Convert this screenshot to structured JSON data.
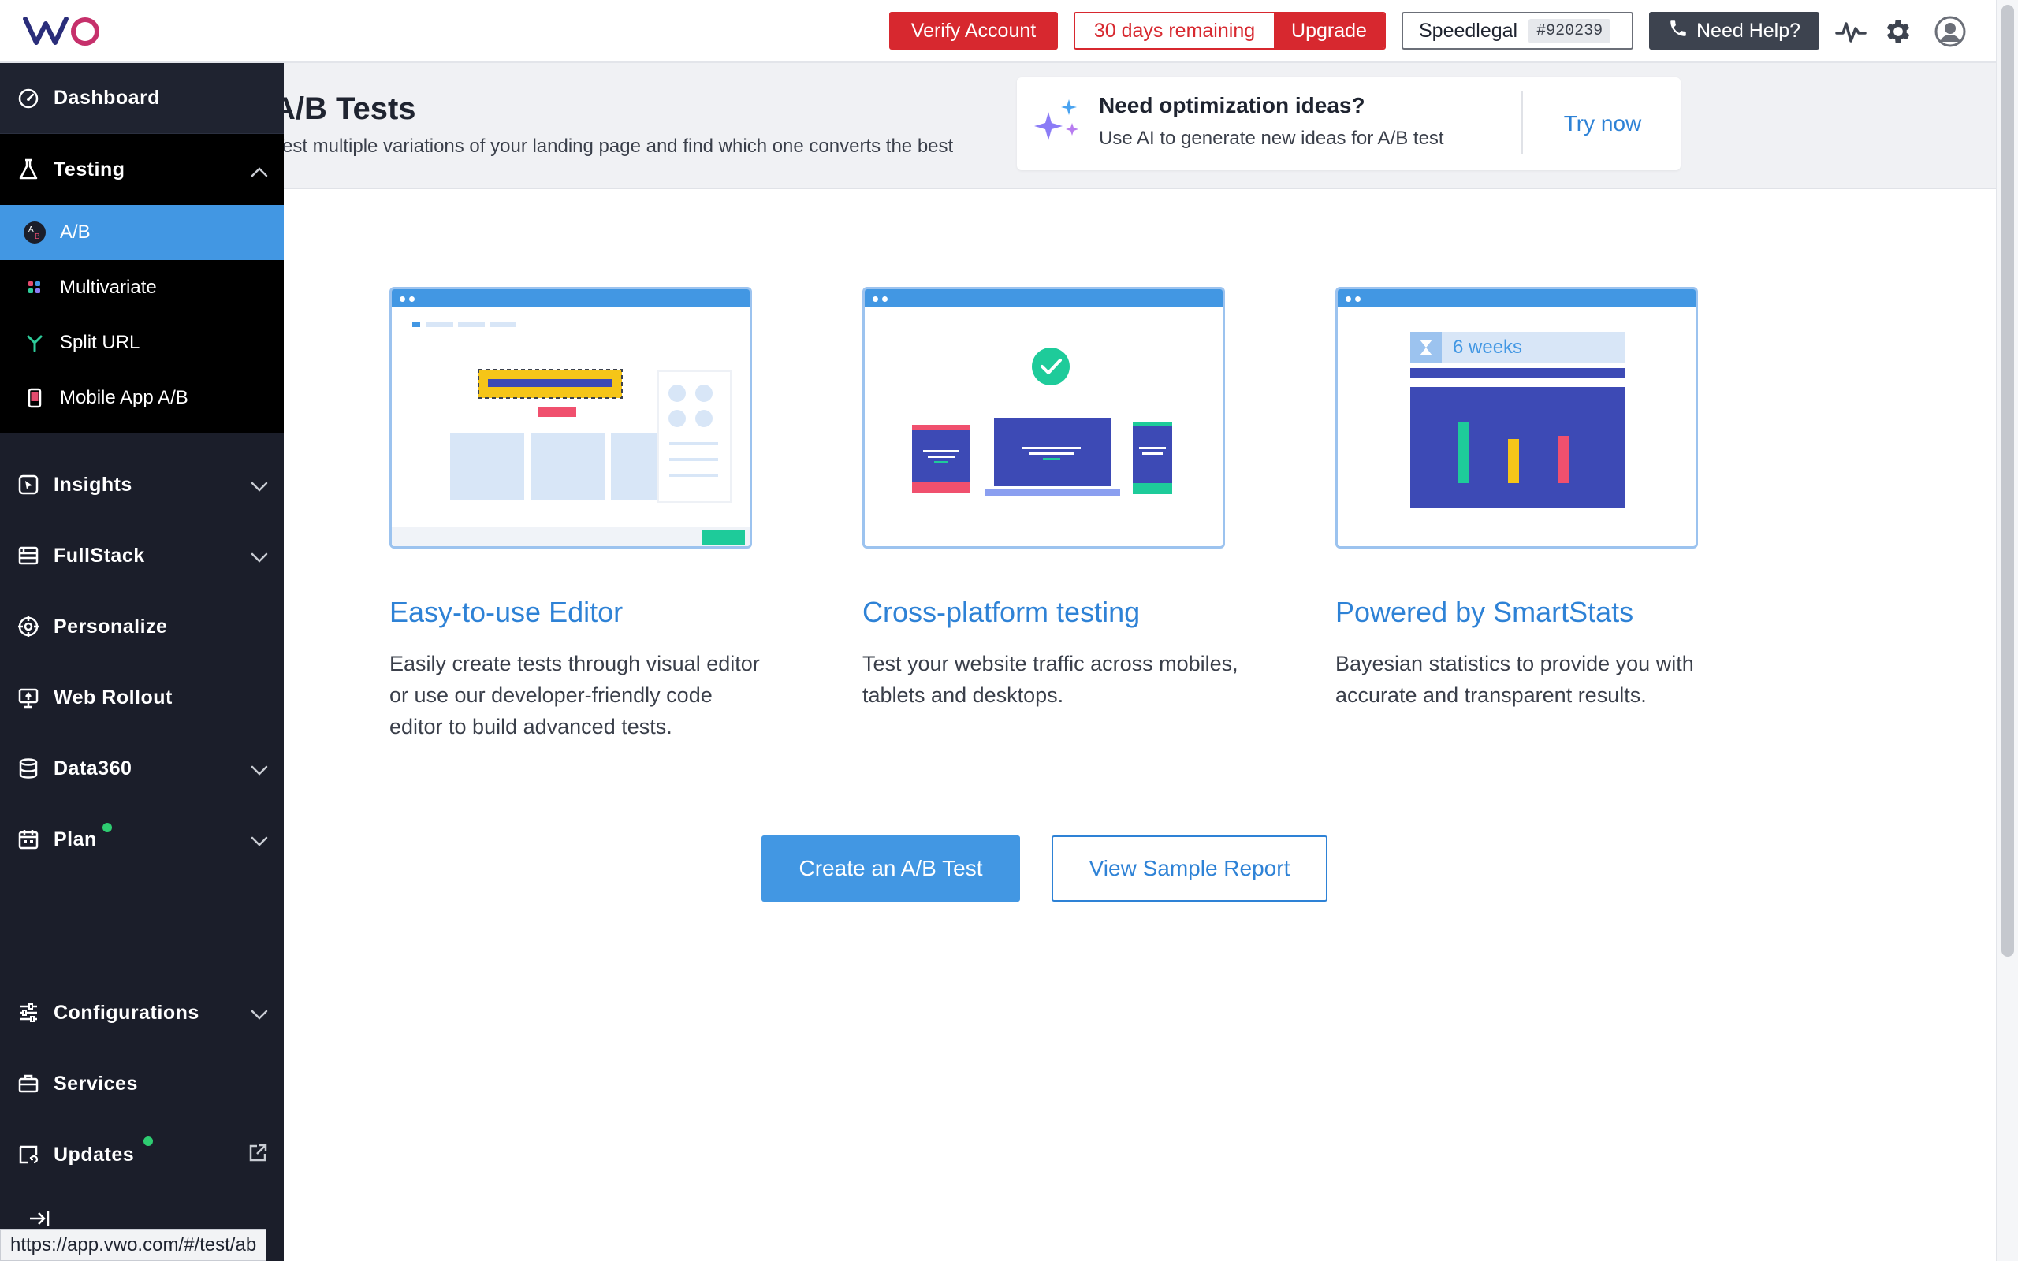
{
  "header": {
    "logo_text": "VWO",
    "verify_label": "Verify Account",
    "trial_days": "30 days remaining",
    "upgrade_label": "Upgrade",
    "account_name": "Speedlegal",
    "account_id": "#920239",
    "help_label": "Need Help?",
    "icons": [
      "activity-icon",
      "gear-icon",
      "user-avatar-icon"
    ]
  },
  "sidebar": {
    "items": [
      {
        "label": "Dashboard",
        "icon": "dashboard-gauge-icon"
      },
      {
        "label": "Testing",
        "icon": "flask-icon",
        "expanded": true
      },
      {
        "label": "Insights",
        "icon": "cursor-box-icon"
      },
      {
        "label": "FullStack",
        "icon": "server-icon"
      },
      {
        "label": "Personalize",
        "icon": "target-icon"
      },
      {
        "label": "Web Rollout",
        "icon": "rollout-icon"
      },
      {
        "label": "Data360",
        "icon": "database-icon"
      },
      {
        "label": "Plan",
        "icon": "calendar-icon",
        "badge": "green-dot"
      },
      {
        "label": "Configurations",
        "icon": "sliders-icon"
      },
      {
        "label": "Services",
        "icon": "briefcase-icon"
      },
      {
        "label": "Updates",
        "icon": "updates-icon",
        "badge": "green-dot"
      }
    ],
    "testing_sub": [
      {
        "label": "A/B",
        "icon": "ab-icon",
        "active": true
      },
      {
        "label": "Multivariate",
        "icon": "multivariate-icon"
      },
      {
        "label": "Split URL",
        "icon": "split-icon"
      },
      {
        "label": "Mobile App A/B",
        "icon": "mobile-icon"
      }
    ]
  },
  "page": {
    "title": "A/B Tests",
    "subtitle": "Test multiple variations of your landing page and find which one converts the best"
  },
  "ai_card": {
    "title": "Need optimization ideas?",
    "desc": "Use AI to generate new ideas for A/B test",
    "cta": "Try now"
  },
  "features": [
    {
      "title": "Easy-to-use Editor",
      "desc": "Easily create tests through visual editor or use our developer-friendly code editor to build advanced tests."
    },
    {
      "title": "Cross-platform testing",
      "desc": "Test your website traffic across mobiles, tablets and desktops."
    },
    {
      "title": "Powered by SmartStats",
      "desc": "Bayesian statistics to provide you with accurate and transparent results.",
      "illus_label": "6 weeks"
    }
  ],
  "actions": {
    "create": "Create an A/B Test",
    "sample": "View Sample Report"
  },
  "statusbar": {
    "url": "https://app.vwo.com/#/test/ab"
  },
  "colors": {
    "accent": "#4297e3",
    "link": "#2e82d6",
    "danger": "#d7282f",
    "sidebar": "#1b1e2a"
  }
}
